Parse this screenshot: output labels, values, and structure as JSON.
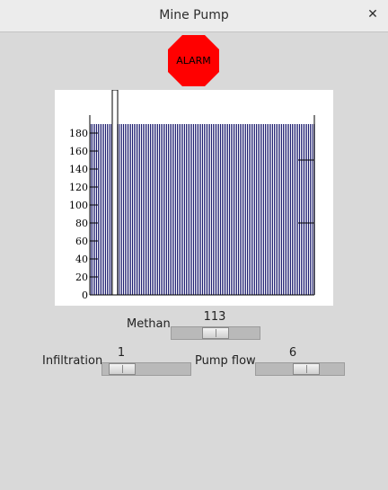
{
  "window": {
    "title": "Mine Pump",
    "close_glyph": "✕"
  },
  "alarm": {
    "label": "ALARM",
    "color": "#ff0000"
  },
  "tank": {
    "axis_ticks": [
      "0",
      "20",
      "40",
      "60",
      "80",
      "100",
      "120",
      "140",
      "160",
      "180"
    ],
    "axis_min": 0,
    "axis_max": 200,
    "water_level": 190,
    "high_marker": 150,
    "low_marker": 80,
    "water_color": "#1a1a6e"
  },
  "sliders": {
    "methan": {
      "label": "Methan",
      "value": "113",
      "fraction": 0.5
    },
    "infiltration": {
      "label": "Infiltration",
      "value": "1",
      "fraction": 0.1
    },
    "pump_flow": {
      "label": "Pump flow",
      "value": "6",
      "fraction": 0.6
    }
  }
}
